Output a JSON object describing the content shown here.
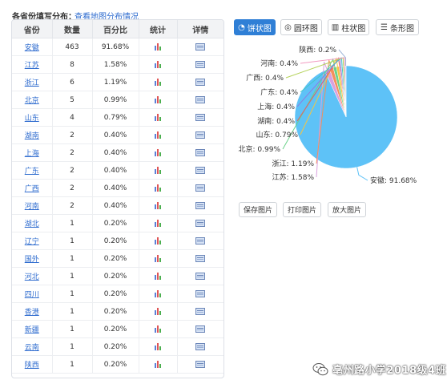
{
  "header": {
    "title": "各省份填写分布：",
    "map_link": "查看地图分布情况"
  },
  "table": {
    "columns": [
      "省份",
      "数量",
      "百分比",
      "统计",
      "详情"
    ],
    "rows": [
      {
        "province": "安徽",
        "count": "463",
        "percent": "91.68%"
      },
      {
        "province": "江苏",
        "count": "8",
        "percent": "1.58%"
      },
      {
        "province": "浙江",
        "count": "6",
        "percent": "1.19%"
      },
      {
        "province": "北京",
        "count": "5",
        "percent": "0.99%"
      },
      {
        "province": "山东",
        "count": "4",
        "percent": "0.79%"
      },
      {
        "province": "湖南",
        "count": "2",
        "percent": "0.40%"
      },
      {
        "province": "上海",
        "count": "2",
        "percent": "0.40%"
      },
      {
        "province": "广东",
        "count": "2",
        "percent": "0.40%"
      },
      {
        "province": "广西",
        "count": "2",
        "percent": "0.40%"
      },
      {
        "province": "河南",
        "count": "2",
        "percent": "0.40%"
      },
      {
        "province": "湖北",
        "count": "1",
        "percent": "0.20%"
      },
      {
        "province": "辽宁",
        "count": "1",
        "percent": "0.20%"
      },
      {
        "province": "国外",
        "count": "1",
        "percent": "0.20%"
      },
      {
        "province": "河北",
        "count": "1",
        "percent": "0.20%"
      },
      {
        "province": "四川",
        "count": "1",
        "percent": "0.20%"
      },
      {
        "province": "香港",
        "count": "1",
        "percent": "0.20%"
      },
      {
        "province": "新疆",
        "count": "1",
        "percent": "0.20%"
      },
      {
        "province": "云南",
        "count": "1",
        "percent": "0.20%"
      },
      {
        "province": "陕西",
        "count": "1",
        "percent": "0.20%"
      }
    ]
  },
  "tabs": [
    {
      "label": "饼状图",
      "icon": "pie-icon",
      "active": true
    },
    {
      "label": "圆环图",
      "icon": "donut-icon",
      "active": false
    },
    {
      "label": "柱状图",
      "icon": "bar-chart-icon",
      "active": false
    },
    {
      "label": "条形图",
      "icon": "horizontal-bar-icon",
      "active": false
    }
  ],
  "buttons": {
    "save": "保存图片",
    "print": "打印图片",
    "zoom": "放大图片"
  },
  "watermark": {
    "text": "亳州路小学2018级4班",
    "icon": "wechat-icon"
  },
  "colors": {
    "link": "#2f6ccf",
    "accent": "#2f7fd6",
    "main_slice": "#5ec2f7"
  },
  "chart_data": {
    "type": "pie",
    "slices": [
      {
        "name": "安徽",
        "value": 91.68,
        "label": "安徽: 91.68%",
        "color": "#5ec2f7"
      },
      {
        "name": "江苏",
        "value": 1.58,
        "label": "江苏: 1.58%",
        "color": "#d9a1de"
      },
      {
        "name": "浙江",
        "value": 1.19,
        "label": "浙江: 1.19%",
        "color": "#f38f5c"
      },
      {
        "name": "北京",
        "value": 0.99,
        "label": "北京: 0.99%",
        "color": "#6cd28a"
      },
      {
        "name": "山东",
        "value": 0.79,
        "label": "山东: 0.79%",
        "color": "#f5c542"
      },
      {
        "name": "湖南",
        "value": 0.4,
        "label": "湖南: 0.4%",
        "color": "#e36060"
      },
      {
        "name": "上海",
        "value": 0.4,
        "label": "上海: 0.4%",
        "color": "#8b7ee0"
      },
      {
        "name": "广东",
        "value": 0.4,
        "label": "广东: 0.4%",
        "color": "#43c6c6"
      },
      {
        "name": "广西",
        "value": 0.4,
        "label": "广西: 0.4%",
        "color": "#b5d25a"
      },
      {
        "name": "河南",
        "value": 0.4,
        "label": "河南: 0.4%",
        "color": "#f29ac0"
      },
      {
        "name": "陕西",
        "value": 0.2,
        "label": "陕西: 0.2%",
        "color": "#9fb6d8"
      }
    ]
  }
}
